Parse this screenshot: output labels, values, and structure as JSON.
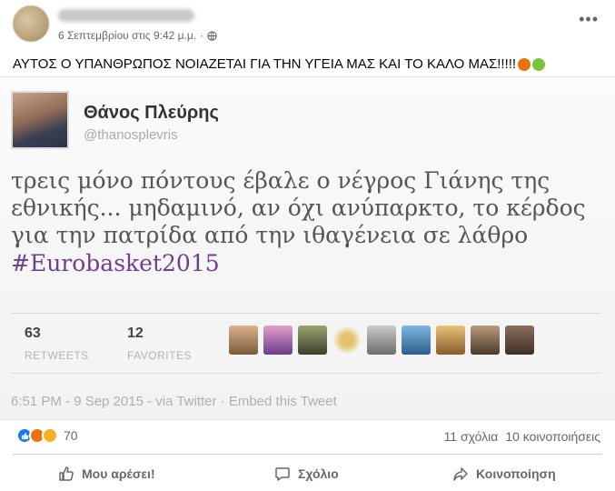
{
  "post": {
    "timestamp": "6 Σεπτεμβρίου στις 9:42 μ.μ.",
    "separator": "·",
    "text": "ΑΥΤΟΣ Ο ΥΠΑΝΘΡΩΠΟΣ ΝΟΙΑΖΕΤΑΙ ΓΙΑ ΤΗΝ ΥΓΕΙΑ ΜΑΣ ΚΑΙ ΤΟ ΚΑΛΟ ΜΑΣ!!!!!",
    "more_icon": "more-horizontal-icon",
    "privacy_icon": "globe-icon"
  },
  "tweet": {
    "name": "Θάνος Πλεύρης",
    "handle": "@thanosplevris",
    "body_lines": [
      "τρεις μόνο πόντους έβαλε ο νέγρος Γιάνης της",
      "εθνικής... μηδαμινό, αν όχι ανύπαρκτο, το κέρδος",
      "για την πατρίδα από την ιθαγένεια σε λάθρο"
    ],
    "hashtag": "#Eurobasket2015",
    "retweets_count": "63",
    "retweets_label": "RETWEETS",
    "favorites_count": "12",
    "favorites_label": "FAVORITES",
    "footer": "6:51 PM - 9 Sep 2015 - via Twitter · Embed this Tweet"
  },
  "engagement": {
    "reaction_count": "70",
    "comments": "11 σχόλια",
    "shares": "10 κοινοποιήσεις"
  },
  "actions": {
    "like_label": "Μου αρέσει!",
    "comment_label": "Σχόλιο",
    "share_label": "Κοινοποίηση"
  },
  "colors": {
    "like_blue": "#1877f2",
    "angry_orange": "#e9710f",
    "haha_yellow": "#f7b125",
    "hashtag_purple": "#6f3f8f",
    "muted_text": "#65676b"
  }
}
